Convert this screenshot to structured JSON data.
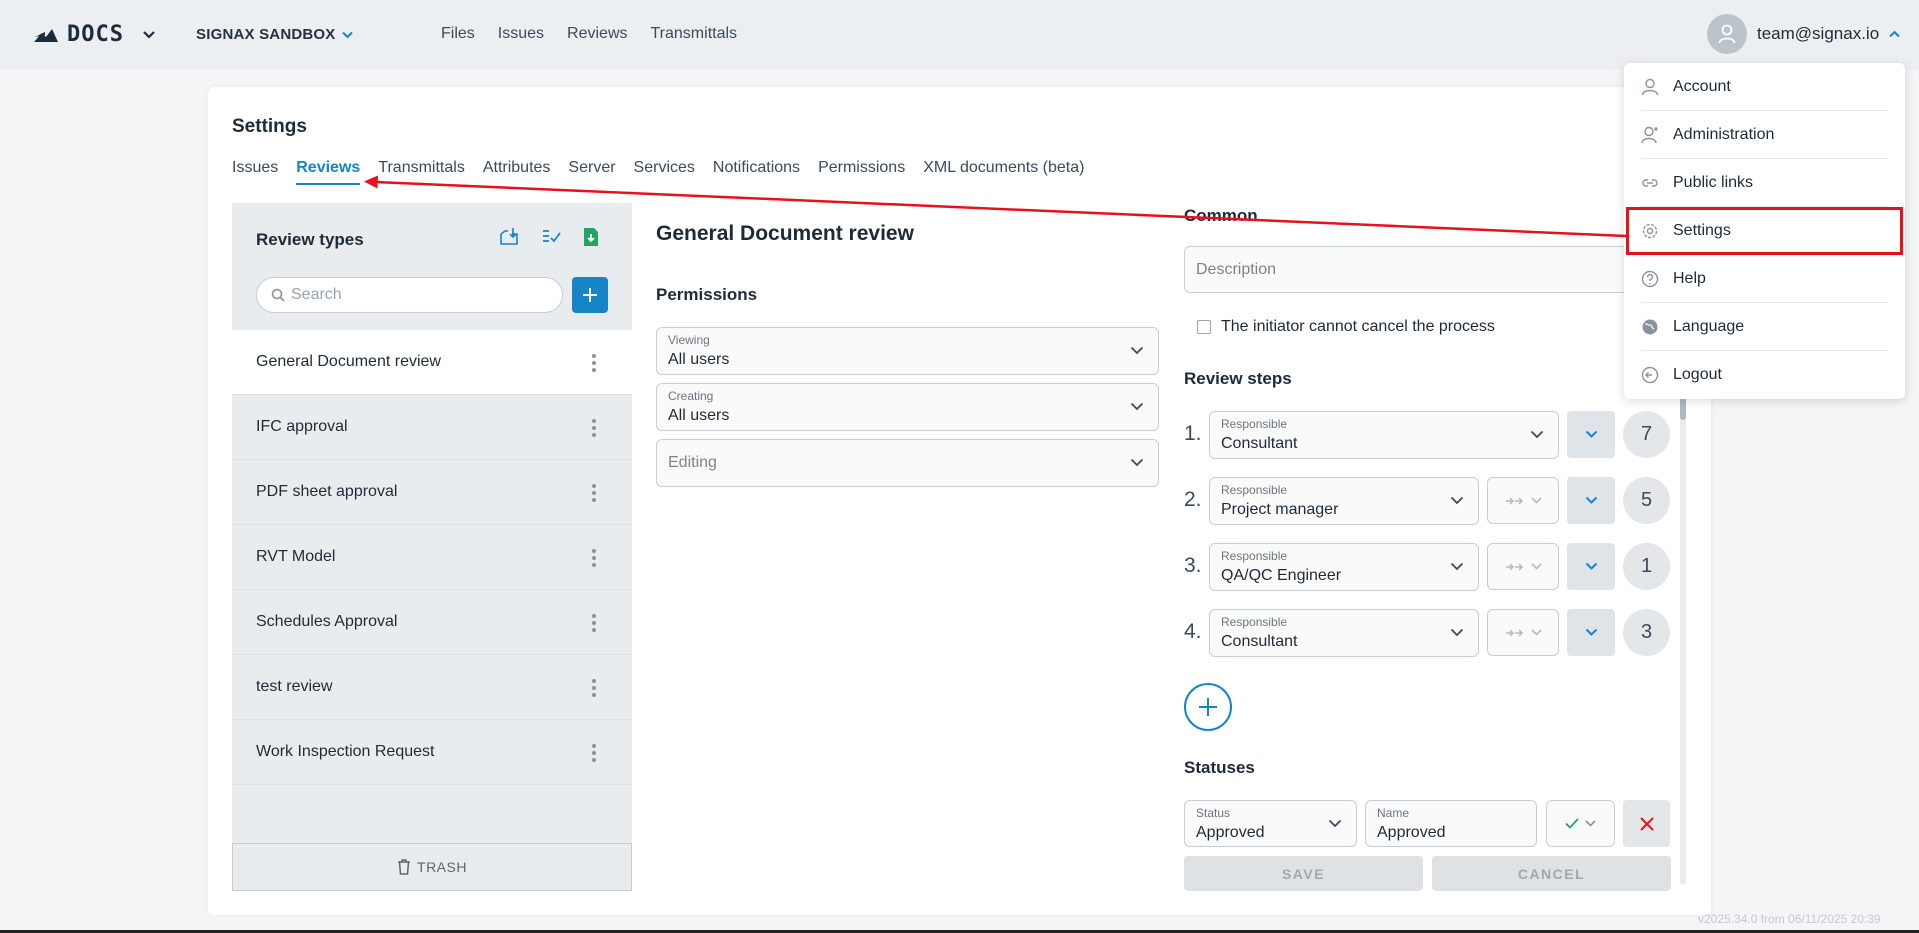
{
  "header": {
    "logo_text": "DOCS",
    "project": "SIGNAX SANDBOX",
    "nav": [
      "Files",
      "Issues",
      "Reviews",
      "Transmittals"
    ],
    "user_email": "team@signax.io"
  },
  "settings": {
    "title": "Settings",
    "tabs": [
      "Issues",
      "Reviews",
      "Transmittals",
      "Attributes",
      "Server",
      "Services",
      "Notifications",
      "Permissions",
      "XML documents (beta)"
    ],
    "active_tab": "Reviews"
  },
  "review_types": {
    "title": "Review types",
    "search_placeholder": "Search",
    "items": [
      "General Document review",
      "IFC approval",
      "PDF sheet approval",
      "RVT Model",
      "Schedules Approval",
      "test review",
      "Work Inspection Request"
    ],
    "selected": "General Document review",
    "trash_label": "TRASH"
  },
  "detail": {
    "title": "General Document review",
    "permissions_title": "Permissions",
    "viewing_label": "Viewing",
    "viewing_value": "All users",
    "creating_label": "Creating",
    "creating_value": "All users",
    "editing_placeholder": "Editing"
  },
  "common": {
    "title": "Common",
    "description_placeholder": "Description",
    "checkbox_label": "The initiator cannot cancel the process",
    "steps_title": "Review steps",
    "responsible_label": "Responsible",
    "steps": [
      {
        "num": "1.",
        "value": "Consultant",
        "count": "7"
      },
      {
        "num": "2.",
        "value": "Project manager",
        "count": "5"
      },
      {
        "num": "3.",
        "value": "QA/QC Engineer",
        "count": "1"
      },
      {
        "num": "4.",
        "value": "Consultant",
        "count": "3"
      }
    ],
    "statuses_title": "Statuses",
    "status_label": "Status",
    "status_value": "Approved",
    "name_label": "Name",
    "name_value": "Approved",
    "save_label": "SAVE",
    "cancel_label": "CANCEL"
  },
  "user_menu": {
    "items": [
      "Account",
      "Administration",
      "Public links",
      "Settings",
      "Help",
      "Language",
      "Logout"
    ],
    "highlighted": "Settings"
  },
  "version": "v2025.34.0 from 06/11/2025 20:39",
  "colors": {
    "accent": "#1585c6",
    "annotation": "#e8101a"
  }
}
